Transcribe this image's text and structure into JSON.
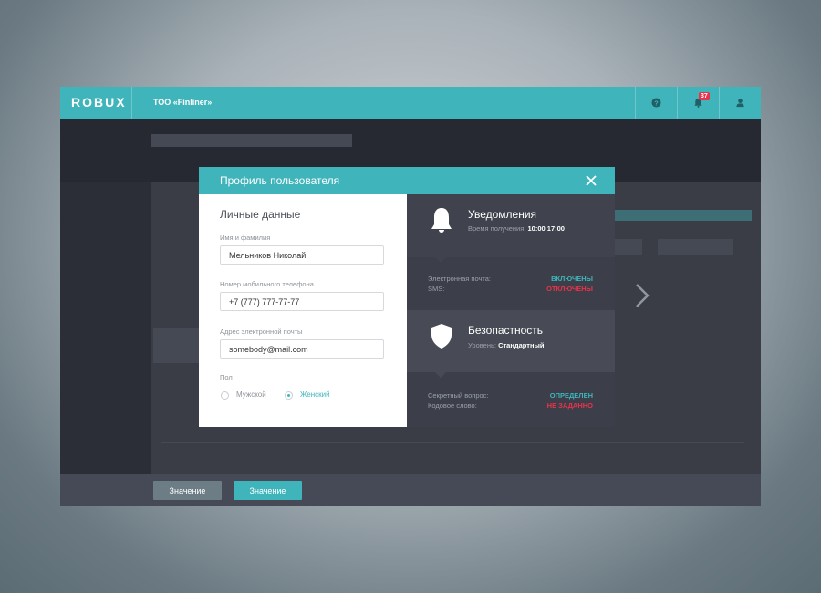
{
  "header": {
    "logo": "ROBUX",
    "company": "ТОО «Finliner»",
    "notifications_count": "37"
  },
  "icons": [
    "help-icon",
    "bell-icon",
    "user-icon",
    "close-icon",
    "chevron-right-icon",
    "shield-icon"
  ],
  "modal": {
    "title": "Профиль пользователя",
    "personal": {
      "section_title": "Личные данные",
      "name_label": "Имя и фамилия",
      "name_value": "Мельников Николай",
      "phone_label": "Номер мобильного телефона",
      "phone_value": "+7 (777) 777-77-77",
      "email_label": "Адрес электронной почты",
      "email_value": "somebody@mail.com",
      "gender_label": "Пол",
      "gender_options": [
        "Мужской",
        "Женский"
      ],
      "gender_selected": "Женский"
    },
    "notifications": {
      "title": "Уведомления",
      "time_label": "Время получения:",
      "time_from": "10:00",
      "time_to": "17:00",
      "email_label": "Электронная почта:",
      "email_status": "ВКЛЮЧЕНЫ",
      "sms_label": "SMS:",
      "sms_status": "ОТКЛЮЧЕНЫ"
    },
    "security": {
      "title": "Безопастность",
      "level_label": "Уровень:",
      "level_value": "Стандартный",
      "question_label": "Секретный вопрос:",
      "question_status": "ОПРЕДЕЛЕН",
      "codeword_label": "Кодовое слово:",
      "codeword_status": "НЕ ЗАДАННО"
    }
  },
  "footer": {
    "button1": "Значение",
    "button2": "Значение"
  },
  "colors": {
    "accent": "#3fb5bb",
    "danger": "#e8334a",
    "panel_dark": "#3c3f49"
  }
}
